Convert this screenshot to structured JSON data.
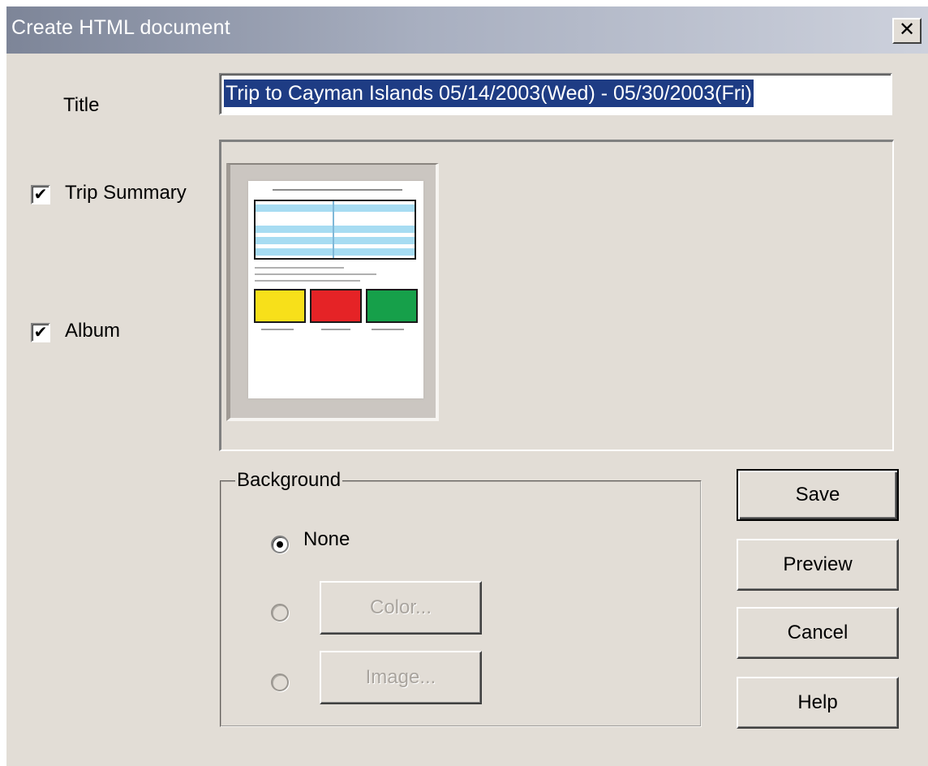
{
  "dialog": {
    "title": "Create HTML document",
    "close_glyph": "✕",
    "close_icon": "close-icon"
  },
  "form": {
    "title_label": "Title",
    "title_value": "Trip to Cayman Islands 05/14/2003(Wed) - 05/30/2003(Fri)"
  },
  "sections": {
    "trip_summary": {
      "label": "Trip Summary",
      "checked": true,
      "check_glyph": "✔"
    },
    "album": {
      "label": "Album",
      "checked": true,
      "check_glyph": "✔"
    }
  },
  "background": {
    "group_label": "Background",
    "selected": "None",
    "options": [
      {
        "label": "None",
        "selected": true,
        "enabled": true
      },
      {
        "button_label": "Color...",
        "selected": false,
        "enabled": false
      },
      {
        "button_label": "Image...",
        "selected": false,
        "enabled": false
      }
    ]
  },
  "preview": {
    "thumbnail_swatch_colors": [
      "#f7e01a",
      "#e52326",
      "#16a04a"
    ]
  },
  "buttons": {
    "save": "Save",
    "preview": "Preview",
    "cancel": "Cancel",
    "help": "Help"
  }
}
